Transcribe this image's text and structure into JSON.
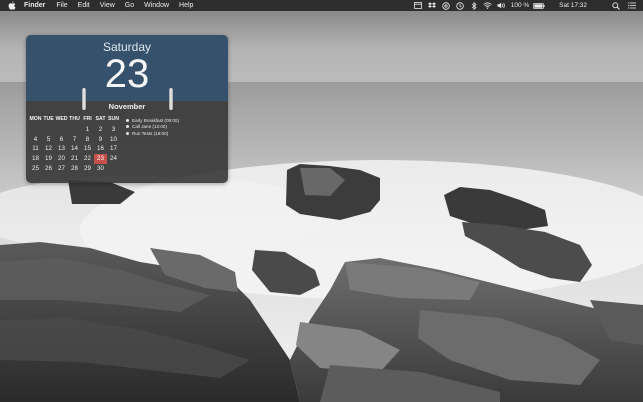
{
  "menubar": {
    "apple_icon": "apple-logo-icon",
    "app_name": "Finder",
    "menus": [
      "File",
      "Edit",
      "View",
      "Go",
      "Window",
      "Help"
    ],
    "status_icons": [
      "calendar-icon",
      "dropbox-icon",
      "at-icon",
      "time-machine-icon",
      "bluetooth-icon",
      "wifi-icon",
      "volume-icon"
    ],
    "battery_text": "100 %",
    "battery_icon": "battery-icon",
    "clock": "Sat 17:32",
    "search_icon": "spotlight-search-icon",
    "list_icon": "notification-center-icon"
  },
  "calendar_widget": {
    "weekday": "Saturday",
    "day": "23",
    "month": "November",
    "header_color": "#36516b",
    "today_color": "#c8504a",
    "weekday_headers": [
      "MON",
      "TUE",
      "WED",
      "THU",
      "FRI",
      "SAT",
      "SUN"
    ],
    "weeks": [
      [
        "",
        "",
        "",
        "",
        "1",
        "2",
        "3"
      ],
      [
        "4",
        "5",
        "6",
        "7",
        "8",
        "9",
        "10"
      ],
      [
        "11",
        "12",
        "13",
        "14",
        "15",
        "16",
        "17"
      ],
      [
        "18",
        "19",
        "20",
        "21",
        "22",
        "23",
        "24"
      ],
      [
        "25",
        "26",
        "27",
        "28",
        "29",
        "30",
        ""
      ]
    ],
    "today": "23",
    "events": [
      "Early Breakfast (08:00)",
      "Call Jane (12:00)",
      "Run Tests (18:00)"
    ]
  }
}
